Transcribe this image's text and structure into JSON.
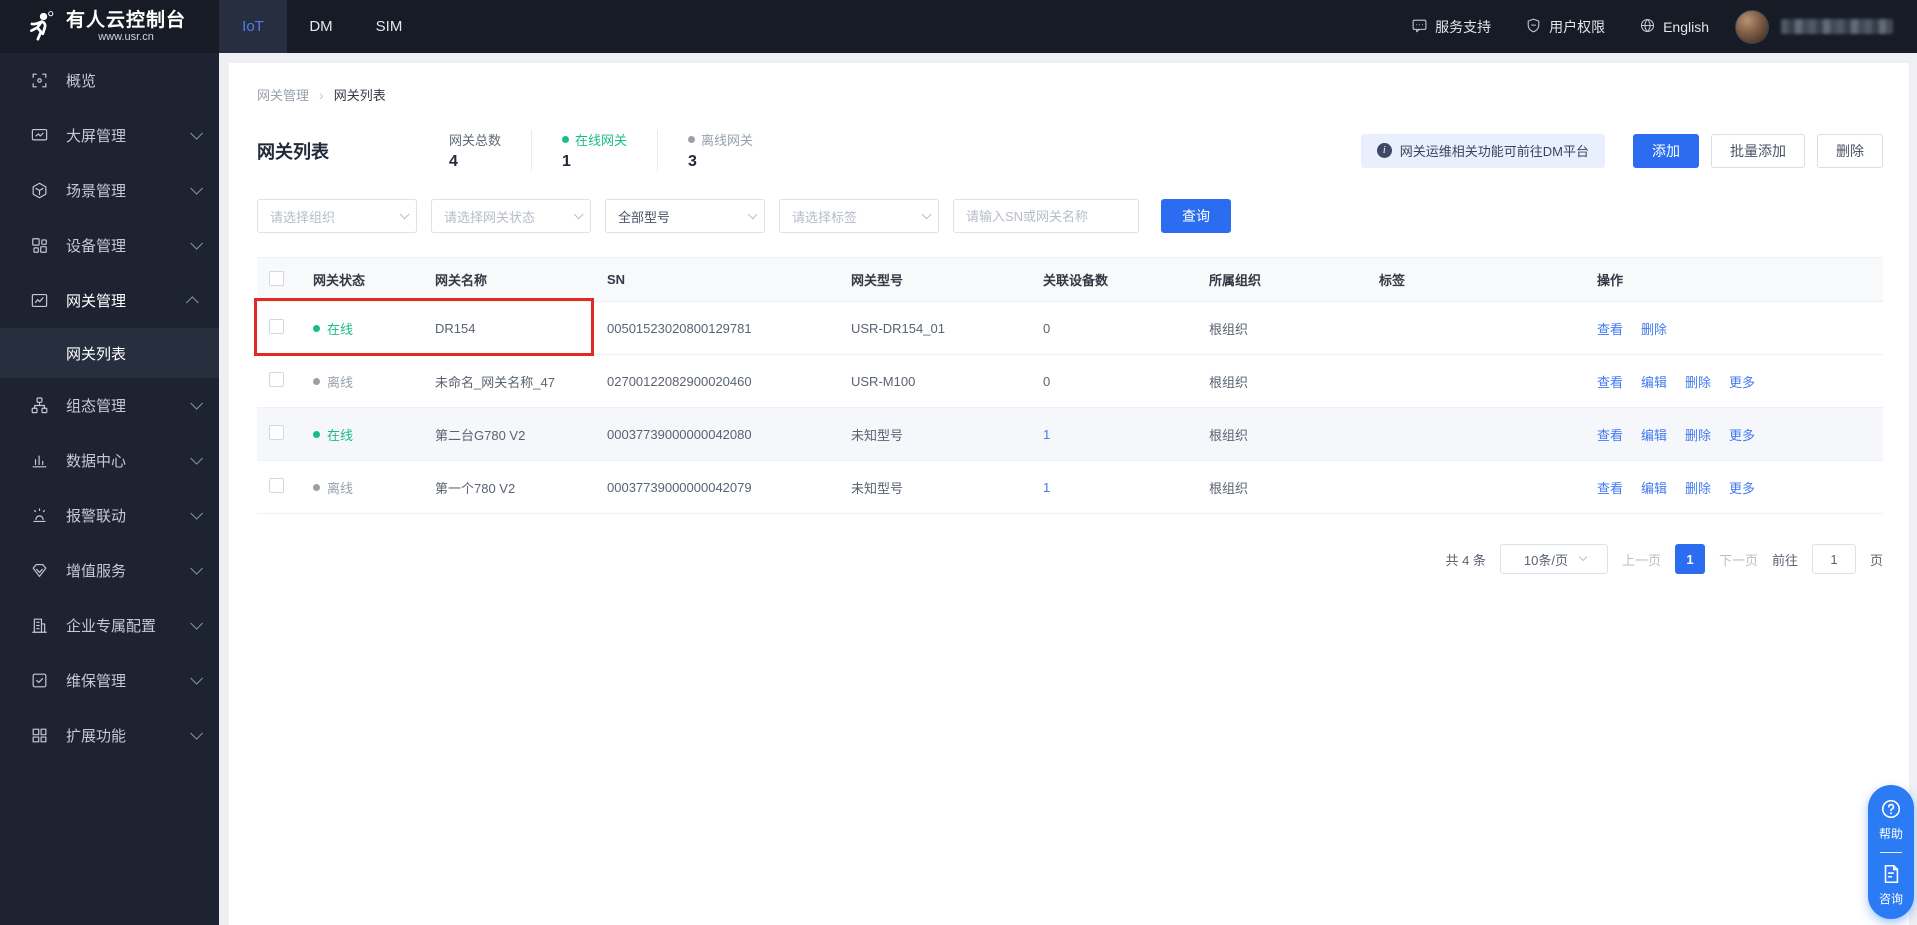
{
  "colors": {
    "primary_blue": "#2b6cf0",
    "link_blue": "#4379f2",
    "online_green": "#1abc84",
    "offline_gray": "#9aa0a6",
    "annotation_red": "#e12a22",
    "header_bg": "#161b25",
    "sidebar_bg": "#1d2330"
  },
  "header": {
    "logo_title": "有人云控制台",
    "logo_subtitle": "www.usr.cn",
    "tabs": [
      {
        "id": "iot",
        "label": "IoT",
        "active": true
      },
      {
        "id": "dm",
        "label": "DM",
        "active": false
      },
      {
        "id": "sim",
        "label": "SIM",
        "active": false
      }
    ],
    "links": [
      {
        "id": "service-support",
        "label": "服务支持",
        "icon": "chat-icon"
      },
      {
        "id": "user-permission",
        "label": "用户权限",
        "icon": "shield-icon"
      },
      {
        "id": "language",
        "label": "English",
        "icon": "globe-icon"
      }
    ]
  },
  "sidebar": {
    "items": [
      {
        "id": "overview",
        "label": "概览",
        "icon": "overview-icon",
        "expandable": false
      },
      {
        "id": "screen-mgmt",
        "label": "大屏管理",
        "icon": "screen-icon",
        "expandable": true
      },
      {
        "id": "scene-mgmt",
        "label": "场景管理",
        "icon": "scene-icon",
        "expandable": true
      },
      {
        "id": "device-mgmt",
        "label": "设备管理",
        "icon": "device-icon",
        "expandable": true
      },
      {
        "id": "gateway-mgmt",
        "label": "网关管理",
        "icon": "gateway-icon",
        "expandable": true,
        "expanded": true,
        "children": [
          {
            "id": "gateway-list",
            "label": "网关列表",
            "active": true
          }
        ]
      },
      {
        "id": "config-mgmt",
        "label": "组态管理",
        "icon": "config-icon",
        "expandable": true
      },
      {
        "id": "data-center",
        "label": "数据中心",
        "icon": "data-icon",
        "expandable": true
      },
      {
        "id": "alarm-linkage",
        "label": "报警联动",
        "icon": "alarm-icon",
        "expandable": true
      },
      {
        "id": "value-added-services",
        "label": "增值服务",
        "icon": "vas-icon",
        "expandable": true
      },
      {
        "id": "enterprise-config",
        "label": "企业专属配置",
        "icon": "enterprise-icon",
        "expandable": true
      },
      {
        "id": "maintenance-mgmt",
        "label": "维保管理",
        "icon": "maintenance-icon",
        "expandable": true
      },
      {
        "id": "extended-functions",
        "label": "扩展功能",
        "icon": "extend-icon",
        "expandable": true
      }
    ]
  },
  "breadcrumb": {
    "parent": "网关管理",
    "separator": "›",
    "current": "网关列表"
  },
  "page": {
    "title": "网关列表",
    "stats": [
      {
        "id": "total",
        "label": "网关总数",
        "value": "4",
        "state": ""
      },
      {
        "id": "online",
        "label": "在线网关",
        "value": "1",
        "state": "online"
      },
      {
        "id": "offline",
        "label": "离线网关",
        "value": "3",
        "state": "offline"
      }
    ],
    "notice": "网关运维相关功能可前往DM平台",
    "buttons": {
      "add": "添加",
      "batch_add": "批量添加",
      "delete": "删除"
    }
  },
  "filters": {
    "org_placeholder": "请选择组织",
    "status_placeholder": "请选择网关状态",
    "model_value": "全部型号",
    "tag_placeholder": "请选择标签",
    "search_placeholder": "请输入SN或网关名称",
    "search_button": "查询"
  },
  "table": {
    "columns": [
      "网关状态",
      "网关名称",
      "SN",
      "网关型号",
      "关联设备数",
      "所属组织",
      "标签",
      "操作"
    ],
    "rows": [
      {
        "status": "在线",
        "online": true,
        "name": "DR154",
        "sn": "00501523020800129781",
        "model": "USR-DR154_01",
        "devices": "0",
        "devices_link": false,
        "org": "根组织",
        "tag": "",
        "actions": [
          "查看",
          "删除"
        ],
        "shaded": false,
        "red_box": true
      },
      {
        "status": "离线",
        "online": false,
        "name": "未命名_网关名称_47",
        "sn": "02700122082900020460",
        "model": "USR-M100",
        "devices": "0",
        "devices_link": false,
        "org": "根组织",
        "tag": "",
        "actions": [
          "查看",
          "编辑",
          "删除",
          "更多"
        ],
        "shaded": false
      },
      {
        "status": "在线",
        "online": true,
        "name": "第二台G780 V2",
        "sn": "00037739000000042080",
        "model": "未知型号",
        "devices": "1",
        "devices_link": true,
        "org": "根组织",
        "tag": "",
        "actions": [
          "查看",
          "编辑",
          "删除",
          "更多"
        ],
        "shaded": true
      },
      {
        "status": "离线",
        "online": false,
        "name": "第一个780 V2",
        "sn": "00037739000000042079",
        "model": "未知型号",
        "devices": "1",
        "devices_link": true,
        "org": "根组织",
        "tag": "",
        "actions": [
          "查看",
          "编辑",
          "删除",
          "更多"
        ],
        "shaded": false
      }
    ]
  },
  "pagination": {
    "total": "共 4 条",
    "page_size": "10条/页",
    "prev": "上一页",
    "current": "1",
    "next": "下一页",
    "goto_label": "前往",
    "goto_value": "1",
    "page_suffix": "页"
  },
  "float_widget": {
    "help": "帮助",
    "consult": "咨询"
  }
}
